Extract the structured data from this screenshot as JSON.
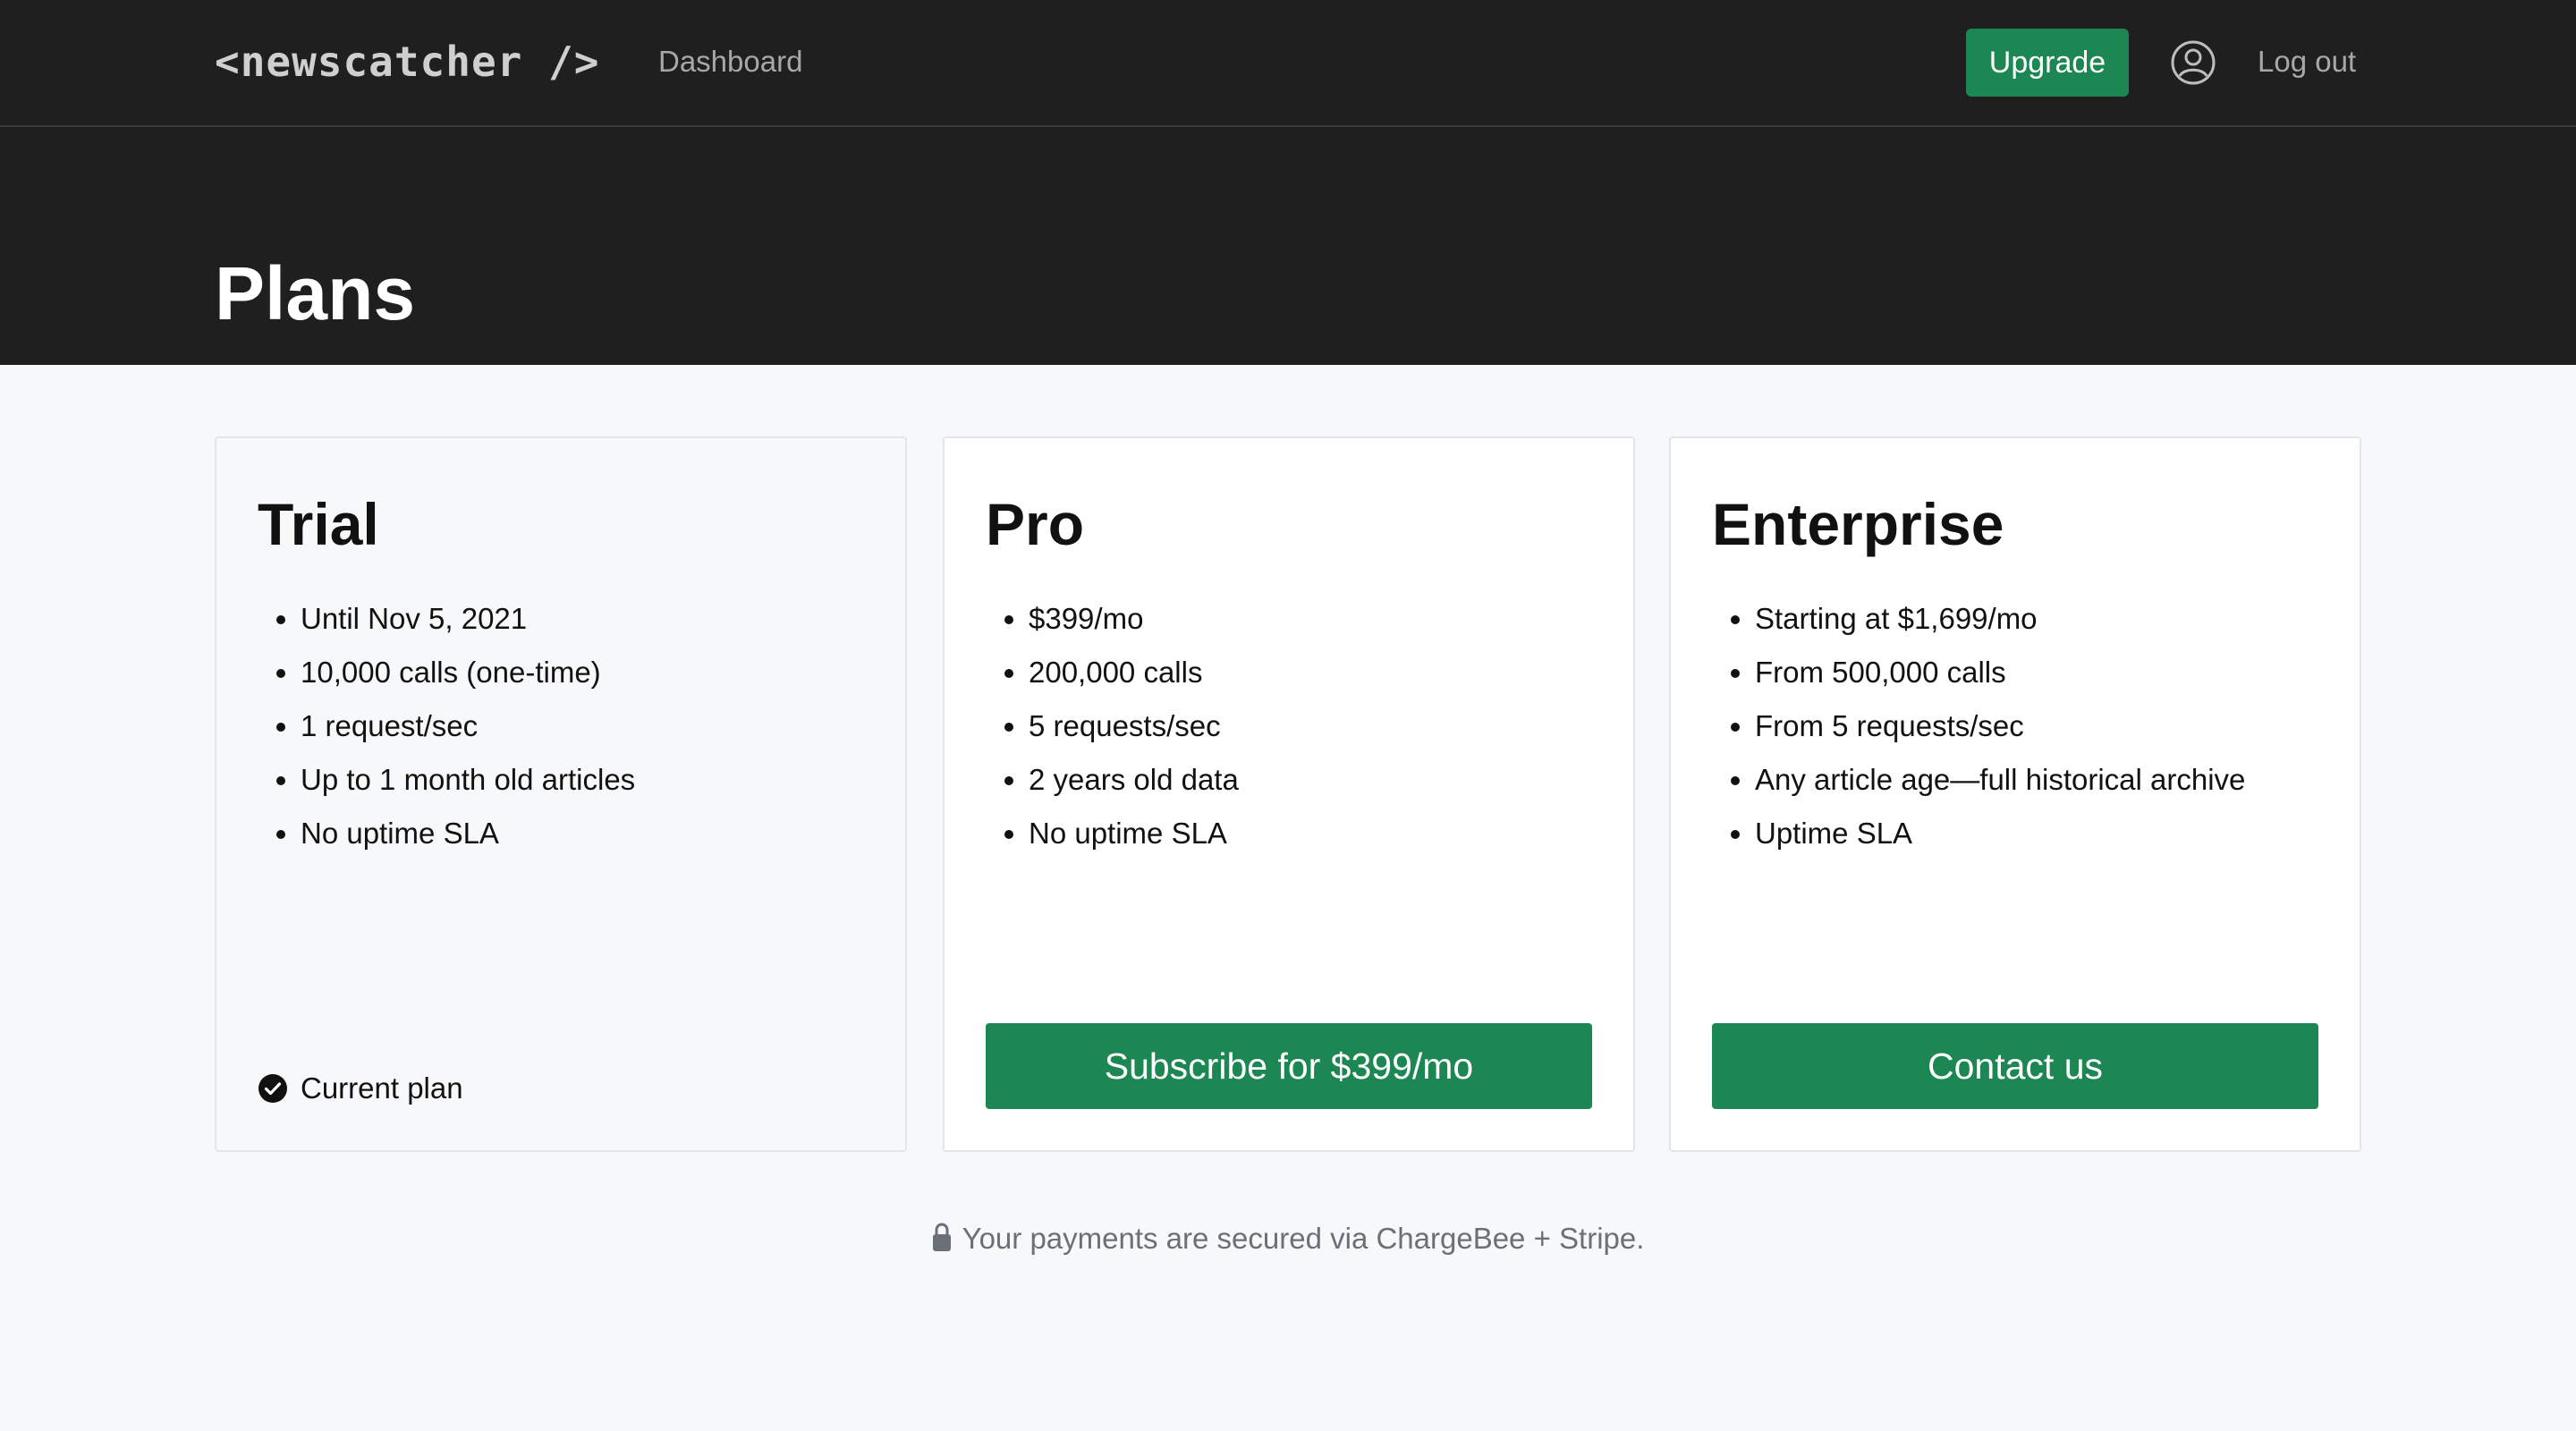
{
  "header": {
    "logo": "<newscatcher />",
    "nav_dashboard": "Dashboard",
    "upgrade_label": "Upgrade",
    "logout_label": "Log out",
    "accent": "#1c8753",
    "background": "#1f1f1f"
  },
  "page": {
    "title": "Plans"
  },
  "plans": [
    {
      "name": "Trial",
      "features": [
        "Until Nov 5, 2021",
        "10,000 calls (one-time)",
        "1 request/sec",
        "Up to 1 month old articles",
        "No uptime SLA"
      ],
      "status_label": "Current plan",
      "status_icon": "check-circle-icon"
    },
    {
      "name": "Pro",
      "features": [
        "$399/mo",
        "200,000 calls",
        "5 requests/sec",
        "2 years old data",
        "No uptime SLA"
      ],
      "cta_label": "Subscribe for $399/mo"
    },
    {
      "name": "Enterprise",
      "features": [
        "Starting at $1,699/mo",
        "From 500,000 calls",
        "From 5 requests/sec",
        "Any article age—full historical archive",
        "Uptime SLA"
      ],
      "cta_label": "Contact us"
    }
  ],
  "footer": {
    "secure_text": "Your payments are secured via ChargeBee + Stripe.",
    "secure_icon": "lock-icon"
  }
}
